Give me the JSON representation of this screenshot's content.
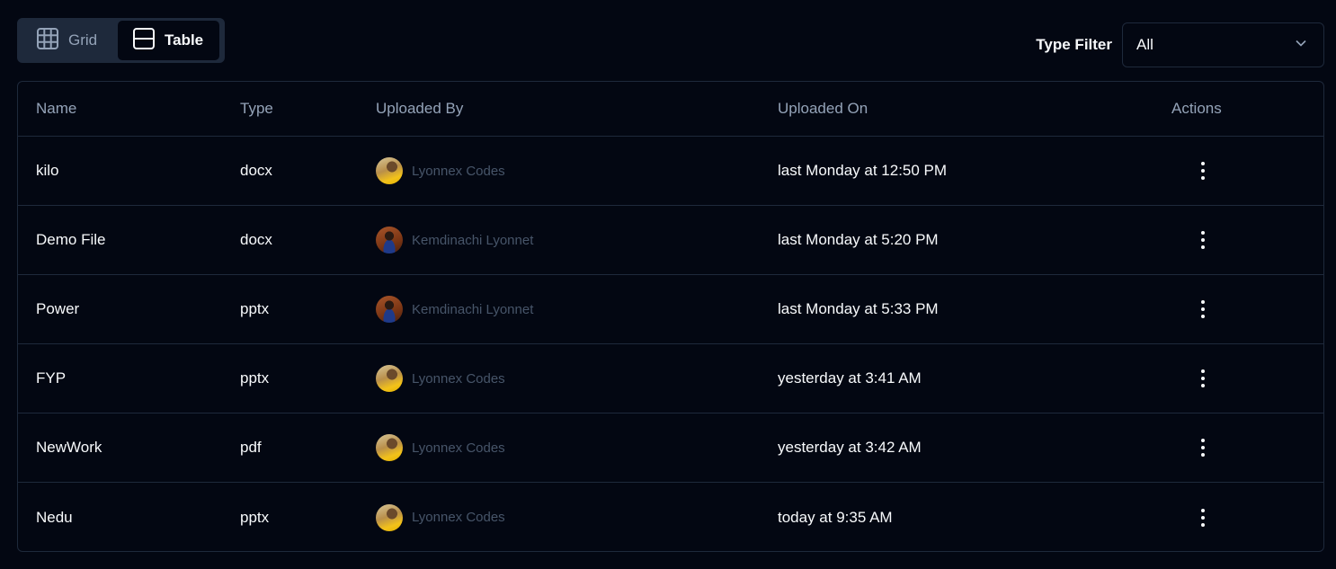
{
  "view_toggle": {
    "grid_label": "Grid",
    "table_label": "Table",
    "active": "Table"
  },
  "filter": {
    "label": "Type Filter",
    "selected": "All"
  },
  "table": {
    "headers": {
      "name": "Name",
      "type": "Type",
      "uploaded_by": "Uploaded By",
      "uploaded_on": "Uploaded On",
      "actions": "Actions"
    },
    "rows": [
      {
        "name": "kilo",
        "type": "docx",
        "uploaded_by": "Lyonnex Codes",
        "uploaded_on": "last Monday at 12:50 PM"
      },
      {
        "name": "Demo File",
        "type": "docx",
        "uploaded_by": "Kemdinachi Lyonnet",
        "uploaded_on": "last Monday at 5:20 PM"
      },
      {
        "name": "Power",
        "type": "pptx",
        "uploaded_by": "Kemdinachi Lyonnet",
        "uploaded_on": "last Monday at 5:33 PM"
      },
      {
        "name": "FYP",
        "type": "pptx",
        "uploaded_by": "Lyonnex Codes",
        "uploaded_on": "yesterday at 3:41 AM"
      },
      {
        "name": "NewWork",
        "type": "pdf",
        "uploaded_by": "Lyonnex Codes",
        "uploaded_on": "yesterday at 3:42 AM"
      },
      {
        "name": "Nedu",
        "type": "pptx",
        "uploaded_by": "Lyonnex Codes",
        "uploaded_on": "today at 9:35 AM"
      }
    ]
  },
  "colors": {
    "background": "#030712",
    "border": "#1e293b",
    "muted_text": "#94a3b8",
    "uploader_text": "#475569",
    "text": "#f8fafc"
  }
}
